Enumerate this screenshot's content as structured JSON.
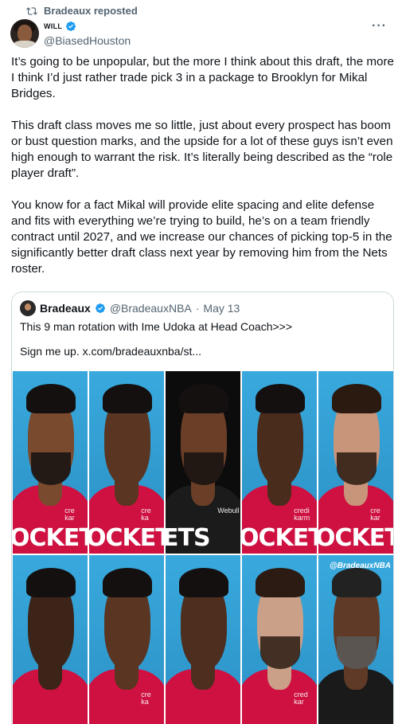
{
  "repost": {
    "text": "Bradeaux reposted",
    "icon": "repost-icon"
  },
  "author": {
    "display_name": "WILL",
    "handle": "@BiasedHouston",
    "verified": true
  },
  "more_label": "···",
  "tweet": {
    "paragraphs": [
      "It’s going to be unpopular, but the more I think about this draft, the more I think I’d just rather trade pick 3 in a package to Brooklyn for Mikal Bridges.",
      "This draft class moves me so little, just about every prospect has boom or bust question marks, and the upside for a lot of these guys isn’t even high enough to warrant the risk. It’s literally being described as the “role player draft”.",
      "You know for a fact Mikal will provide elite spacing and elite defense and fits with everything we’re trying to build, he’s on a team friendly contract until 2027, and we increase our chances of picking top-5 in the significantly better draft class next year by removing him from the Nets roster."
    ]
  },
  "quote": {
    "name": "Bradeaux",
    "handle": "@BradeauxNBA",
    "separator": "·",
    "date": "May 13",
    "text_line1": "This 9 man rotation with Ime Udoka at Head Coach>>>",
    "text_line2": "Sign me up.  x.com/bradeauxnba/st...",
    "watermark": "@BradeauxNBA",
    "tiles": [
      {
        "word": "OCKET",
        "sponsor": "cre\nkar"
      },
      {
        "word": "OCKET",
        "sponsor": "cre\nka"
      },
      {
        "word": "ETS",
        "sponsor": "Webull"
      },
      {
        "word": "OCKETS",
        "sponsor": "credi\nkarm"
      },
      {
        "word": "OCKET",
        "sponsor": "cre\nkar"
      },
      {
        "word": "",
        "sponsor": ""
      },
      {
        "word": "",
        "sponsor": "cre\nka"
      },
      {
        "word": "",
        "sponsor": ""
      },
      {
        "word": "",
        "sponsor": "cred\nkar"
      },
      {
        "word": "",
        "sponsor": ""
      }
    ]
  },
  "colors": {
    "accent": "#1d9bf0",
    "rockets_red": "#ce1141",
    "nets_black": "#111111",
    "photo_blue": "#2f9fd6"
  }
}
